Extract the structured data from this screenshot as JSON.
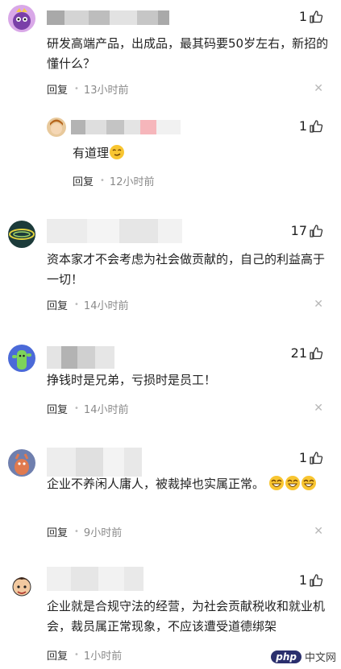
{
  "comments": [
    {
      "likes": "1",
      "text": "研发高端产品，出成品，最其码要50岁左右，新招的懂什么？",
      "reply_label": "回复",
      "time": "13小时前",
      "sub_reply": {
        "likes": "1",
        "text": "有道理",
        "reply_label": "回复",
        "time": "12小时前"
      }
    },
    {
      "likes": "17",
      "text": "资本家才不会考虑为社会做贡献的，自己的利益高于一切！",
      "reply_label": "回复",
      "time": "14小时前"
    },
    {
      "likes": "21",
      "text": "挣钱时是兄弟，亏损时是员工！",
      "reply_label": "回复",
      "time": "14小时前"
    },
    {
      "likes": "1",
      "text": "企业不养闲人庸人，被裁掉也实属正常。",
      "reply_label": "回复",
      "time": "9小时前"
    },
    {
      "likes": "1",
      "text": "企业就是合规守法的经营，为社会贡献税收和就业机会，裁员属正常现象，不应该遭受道德绑架",
      "reply_label": "回复",
      "time": "1小时前"
    }
  ],
  "icons": {
    "like": "thumbs-up-icon",
    "close": "close-icon",
    "emoji_smirk": "smirk-emoji-icon",
    "emoji_laugh": "laugh-emoji-icon"
  },
  "watermark": {
    "logo": "php",
    "text": "中文网"
  }
}
